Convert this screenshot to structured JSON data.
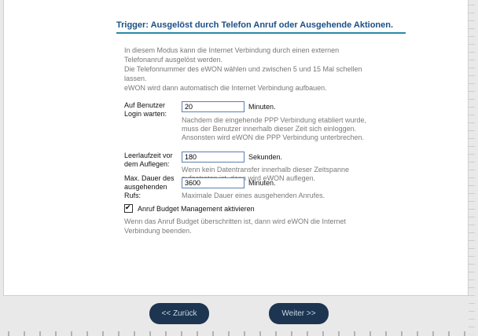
{
  "title": "Trigger: Ausgelöst durch Telefon Anruf oder Ausgehende Aktionen.",
  "intro": [
    "In diesem Modus kann die Internet Verbindung durch einen externen",
    "Telefonanruf ausgelöst werden.",
    "Die Telefonnummer des eWON wählen und zwischen 5 und 15 Mal schellen",
    "lassen.",
    "eWON wird dann automatisch die Internet Verbindung aufbauen."
  ],
  "login_wait": {
    "label": [
      "Auf Benutzer",
      "Login warten:"
    ],
    "value": "20",
    "unit": "Minuten.",
    "help": [
      "Nachdem die eingehende PPP Verbindung etabliert wurde,",
      "muss der Benutzer innerhalb dieser Zeit sich einloggen.",
      "Ansonsten wird eWON die PPP Verbindung unterbrechen."
    ]
  },
  "idle_time": {
    "label": [
      "Leerlaufzeit vor",
      "dem Auflegen:"
    ],
    "value": "180",
    "unit": "Sekunden.",
    "help": [
      "Wenn kein Datentransfer innerhalb dieser Zeitspanne",
      "aufgetreten ist, dann wird eWON auflegen."
    ]
  },
  "max_duration": {
    "label": [
      "Max. Dauer des",
      "ausgehenden",
      "Rufs:"
    ],
    "value": "3600",
    "unit": "Minuten.",
    "help": [
      "Maximale Dauer eines ausgehenden Anrufes."
    ]
  },
  "budget": {
    "label": "Anruf Budget Management aktivieren",
    "checked": true,
    "check_glyph": "✔",
    "help": [
      "Wenn das Anruf Budget überschritten ist, dann wird eWON die Internet",
      "Verbindung beenden."
    ]
  },
  "buttons": {
    "back": "<< Zurück",
    "next": "Weiter >>"
  }
}
